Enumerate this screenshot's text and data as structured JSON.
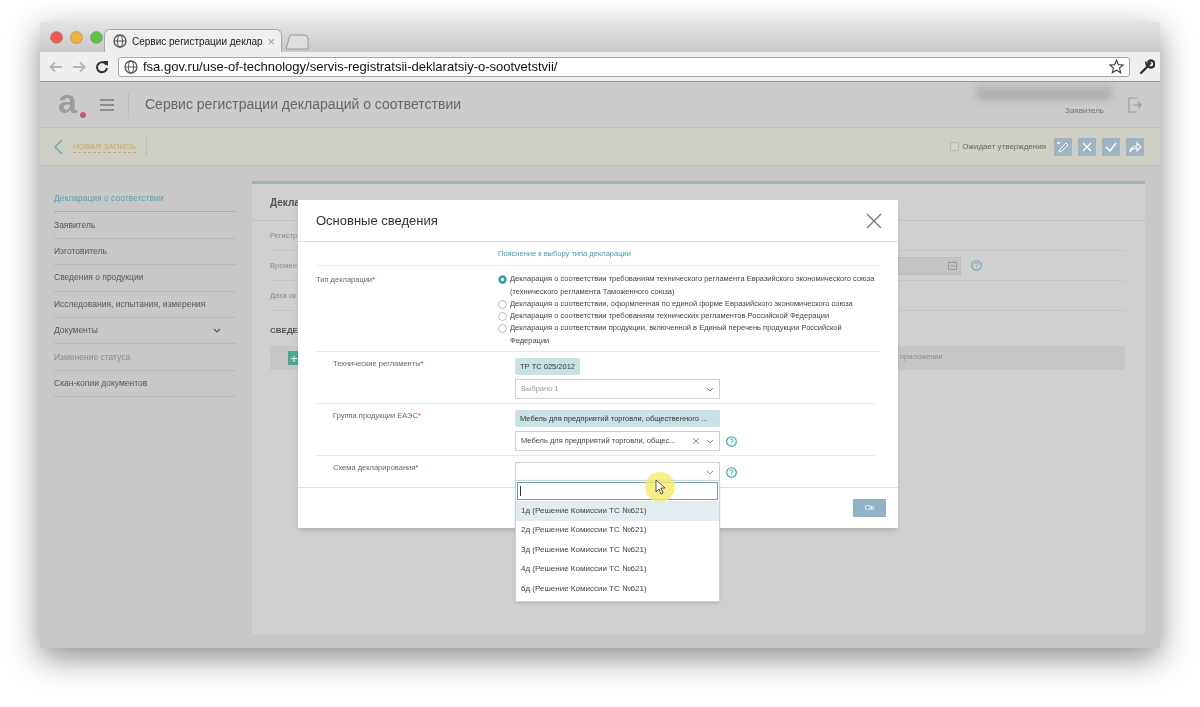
{
  "browser": {
    "tab_title": "Сервис регистрации деклар",
    "tab_close": "×",
    "url": "fsa.gov.ru/use-of-technology/servis-registratsii-deklaratsiy-o-sootvetstvii/"
  },
  "app": {
    "logo": "а",
    "title": "Сервис регистрации деклараций о соответствии",
    "user_role": "Заявитель",
    "breadcrumb": "НОВАЯ ЗАПИСЬ",
    "status_checkbox": {
      "label": "Ожидает утверждения",
      "checked": false
    }
  },
  "sidebar": {
    "items": [
      {
        "label": "Декларация о соответствии",
        "selected": true,
        "disabled": false,
        "expandable": false
      },
      {
        "label": "Заявитель",
        "selected": false,
        "disabled": false,
        "expandable": false
      },
      {
        "label": "Изготовитель",
        "selected": false,
        "disabled": false,
        "expandable": false
      },
      {
        "label": "Сведения о продукции",
        "selected": false,
        "disabled": false,
        "expandable": false
      },
      {
        "label": "Исследования, испытания, измерения",
        "selected": false,
        "disabled": false,
        "expandable": false
      },
      {
        "label": "Документы",
        "selected": false,
        "disabled": false,
        "expandable": true
      },
      {
        "label": "Изменение статуса",
        "selected": false,
        "disabled": true,
        "expandable": false
      },
      {
        "label": "Скан-копии документов",
        "selected": false,
        "disabled": false,
        "expandable": false
      }
    ]
  },
  "background_panel": {
    "heading": "Декла",
    "fields": [
      "Регистр",
      "Времен",
      "Дата ок"
    ],
    "section": "СВЕДЕ",
    "add_button": "+",
    "column_label": "приложении"
  },
  "modal": {
    "title": "Основные сведения",
    "hint_link": "Пояснение к выбору типа декларации",
    "declaration_type": {
      "label": "Тип декларации",
      "mark": "*",
      "options": [
        {
          "label": "Декларация о соответствии требованиям технического регламента Евразийского экономического союза (технического регламента Таможенного союза)",
          "selected": true
        },
        {
          "label": "Декларация о соответствии, оформленная по единой форме Евразийского экономического союза",
          "selected": false
        },
        {
          "label": "Декларация о соответствии требованиям технических регламентов Российской Федерации",
          "selected": false
        },
        {
          "label": "Декларация о соответствии продукции, включенной в Единый перечень продукции Российской Федерации",
          "selected": false
        }
      ]
    },
    "select_fields": [
      {
        "label": "Технические регламенты",
        "mark": "*",
        "tag": "ТР ТС 025/2012",
        "value": "Выбрано 1",
        "placeholder_style": true,
        "clearable": false,
        "help": false
      },
      {
        "label": "Группа продукции ЕАЭС",
        "mark": "*",
        "tag": "Мебель для предприятий торговли, общественного ...",
        "value": "Мебель для предприятий торговли, общес...",
        "placeholder_style": false,
        "clearable": true,
        "help": true
      },
      {
        "label": "Схема декларирования",
        "mark": "*",
        "clearable": false,
        "help": true
      }
    ],
    "ok_button": "Ок"
  },
  "dropdown": {
    "options": [
      {
        "label": "1д (Решение Комиссии ТС №621)",
        "highlighted": true
      },
      {
        "label": "2д (Решение Комиссии ТС №621)",
        "highlighted": false
      },
      {
        "label": "3д (Решение Комиссии ТС №621)",
        "highlighted": false
      },
      {
        "label": "4д (Решение Комиссии ТС №621)",
        "highlighted": false
      },
      {
        "label": "6д (Решение Комиссии ТС №621)",
        "highlighted": false
      }
    ]
  }
}
